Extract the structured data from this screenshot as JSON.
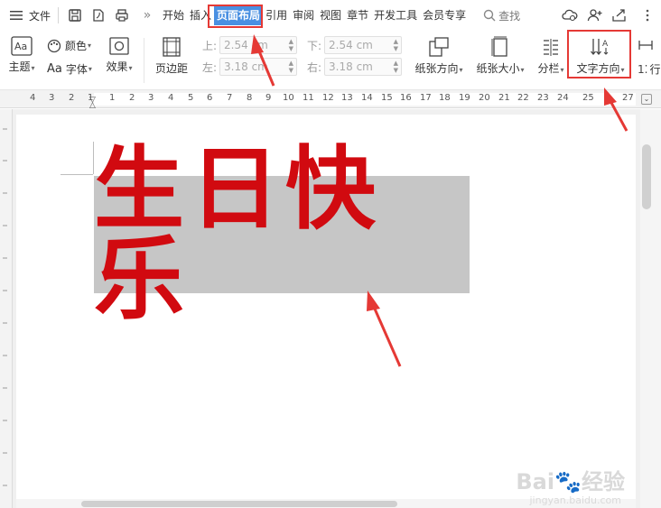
{
  "menubar": {
    "file_label": "文件",
    "more_glyph": "»",
    "tabs": [
      {
        "label": "开始",
        "active": false
      },
      {
        "label": "插入",
        "active": false
      },
      {
        "label": "页面布局",
        "active": true
      },
      {
        "label": "引用",
        "active": false
      },
      {
        "label": "审阅",
        "active": false
      },
      {
        "label": "视图",
        "active": false
      },
      {
        "label": "章节",
        "active": false
      },
      {
        "label": "开发工具",
        "active": false
      },
      {
        "label": "会员专享",
        "active": false
      }
    ],
    "search_label": "查找"
  },
  "ribbon": {
    "theme_label": "主题",
    "color_label": "颜色",
    "font_label": "字体",
    "font_prefix": "Aa",
    "effect_label": "效果",
    "margin_label": "页边距",
    "top_label": "上:",
    "top_value": "2.54 cm",
    "bottom_label": "下:",
    "bottom_value": "2.54 cm",
    "left_label": "左:",
    "left_value": "3.18 cm",
    "right_label": "右:",
    "right_value": "3.18 cm",
    "orientation_label": "纸张方向",
    "size_label": "纸张大小",
    "columns_label": "分栏",
    "text_direction_label": "文字方向",
    "extra1": "行"
  },
  "ruler": {
    "numbers": [
      "4",
      "3",
      "2",
      "1",
      "1",
      "2",
      "3",
      "4",
      "5",
      "6",
      "7",
      "8",
      "9",
      "10",
      "11",
      "12",
      "13",
      "14",
      "15",
      "16",
      "17",
      "18",
      "19",
      "20",
      "21",
      "22",
      "23",
      "24",
      "25",
      "27"
    ]
  },
  "document": {
    "text": "生日快乐"
  },
  "watermark": {
    "main": "Bai",
    "brand": "经验",
    "sub": "jingyan.baidu.com"
  },
  "colors": {
    "accent": "#4a90e2",
    "highlight": "#e53935",
    "text_red": "#d10a10",
    "textbox_bg": "#c6c6c6"
  }
}
